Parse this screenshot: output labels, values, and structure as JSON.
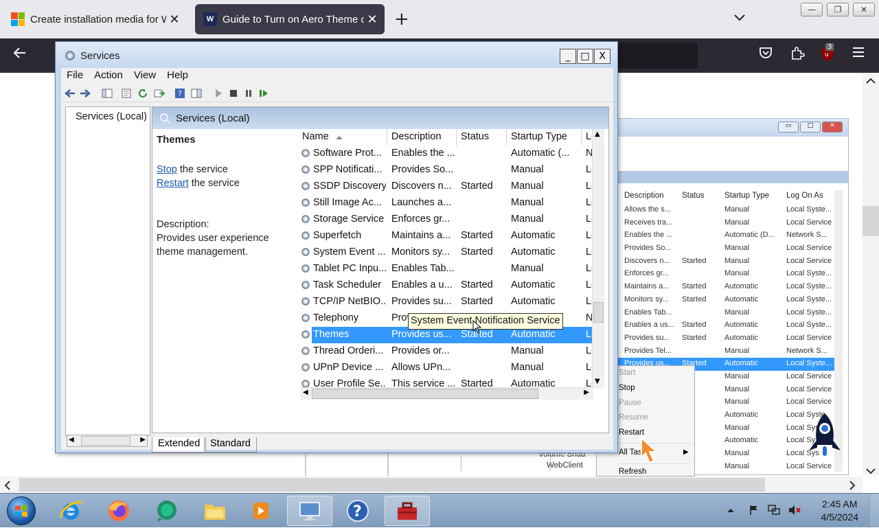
{
  "browser": {
    "tabs": [
      {
        "title": "Create installation media for W",
        "close": "✕"
      },
      {
        "title": "Guide to Turn on Aero Theme o",
        "close": "✕"
      }
    ],
    "new_tab": "+",
    "tab_list": "⌄",
    "window_controls": [
      "—",
      "❐",
      "✕"
    ],
    "extension_badge": "3"
  },
  "services_window": {
    "title": "Services",
    "controls": {
      "minimize": "_",
      "maximize": "□",
      "close": "X"
    },
    "menu": [
      "File",
      "Action",
      "View",
      "Help"
    ],
    "tree_root": "Services (Local)",
    "detail_header": "Services (Local)",
    "selected_service": {
      "name": "Themes",
      "stop_link": "Stop",
      "stop_suffix": " the service",
      "restart_link": "Restart",
      "restart_suffix": " the service",
      "description_label": "Description:",
      "description_line1": "Provides user experience",
      "description_line2": "theme management."
    },
    "columns": [
      "Name",
      "Description",
      "Status",
      "Startup Type",
      "Lo"
    ],
    "rows": [
      {
        "name": "Software Prot...",
        "desc": "Enables the ...",
        "status": "",
        "startup": "Automatic (...",
        "logon": "N"
      },
      {
        "name": "SPP Notificati...",
        "desc": "Provides So...",
        "status": "",
        "startup": "Manual",
        "logon": "Lo"
      },
      {
        "name": "SSDP Discovery",
        "desc": "Discovers n...",
        "status": "Started",
        "startup": "Manual",
        "logon": "Lo"
      },
      {
        "name": "Still Image Ac...",
        "desc": "Launches a...",
        "status": "",
        "startup": "Manual",
        "logon": "Lo"
      },
      {
        "name": "Storage Service",
        "desc": "Enforces gr...",
        "status": "",
        "startup": "Manual",
        "logon": "Lo"
      },
      {
        "name": "Superfetch",
        "desc": "Maintains a...",
        "status": "Started",
        "startup": "Automatic",
        "logon": "Lo"
      },
      {
        "name": "System Event ...",
        "desc": "Monitors sy...",
        "status": "Started",
        "startup": "Automatic",
        "logon": "Lo"
      },
      {
        "name": "Tablet PC Inpu...",
        "desc": "Enables Tab...",
        "status": "",
        "startup": "Manual",
        "logon": "Lo"
      },
      {
        "name": "Task Scheduler",
        "desc": "Enables a u...",
        "status": "Started",
        "startup": "Automatic",
        "logon": "Lo"
      },
      {
        "name": "TCP/IP NetBIO...",
        "desc": "Provides su...",
        "status": "Started",
        "startup": "Automatic",
        "logon": "Lo"
      },
      {
        "name": "Telephony",
        "desc": "Provides Tel...",
        "status": "",
        "startup": "Manual",
        "logon": "N"
      },
      {
        "name": "Themes",
        "desc": "Provides us...",
        "status": "Started",
        "startup": "Automatic",
        "logon": "Lo"
      },
      {
        "name": "Thread Orderi...",
        "desc": "Provides or...",
        "status": "",
        "startup": "Manual",
        "logon": "Lo"
      },
      {
        "name": "UPnP Device ...",
        "desc": "Allows UPn...",
        "status": "",
        "startup": "Manual",
        "logon": "Lo"
      },
      {
        "name": "User Profile Se...",
        "desc": "This service ...",
        "status": "Started",
        "startup": "Automatic",
        "logon": "Lo"
      }
    ],
    "tooltip": "System Event Notification Service",
    "view_tabs": [
      "Extended",
      "Standard"
    ]
  },
  "background_screenshot": {
    "columns": [
      "Description",
      "Status",
      "Startup Type",
      "Log On As"
    ],
    "rows": [
      [
        "Allows the s...",
        "",
        "Manual",
        "Local Syste..."
      ],
      [
        "Receives tra...",
        "",
        "Manual",
        "Local Service"
      ],
      [
        "Enables the ...",
        "",
        "Automatic (D...",
        "Network S..."
      ],
      [
        "Provides So...",
        "",
        "Manual",
        "Local Service"
      ],
      [
        "Discovers n...",
        "Started",
        "Manual",
        "Local Service"
      ],
      [
        "Enforces gr...",
        "",
        "Manual",
        "Local Syste..."
      ],
      [
        "Maintains a...",
        "Started",
        "Automatic",
        "Local Syste..."
      ],
      [
        "Monitors sy...",
        "Started",
        "Automatic",
        "Local Syste..."
      ],
      [
        "Enables Tab...",
        "",
        "Manual",
        "Local Syste..."
      ],
      [
        "Enables a us...",
        "Started",
        "Automatic",
        "Local Syste..."
      ],
      [
        "Provides su...",
        "Started",
        "Automatic",
        "Local Service"
      ],
      [
        "Provides Tel...",
        "",
        "Manual",
        "Network S..."
      ],
      [
        "Provides us...",
        "Started",
        "Automatic",
        "Local Syste..."
      ],
      [
        "",
        "",
        "Manual",
        "Local Service"
      ],
      [
        "",
        "",
        "Manual",
        "Local Service"
      ],
      [
        "",
        "",
        "Manual",
        "Local Service"
      ],
      [
        "",
        "ted",
        "Automatic",
        "Local Syste"
      ],
      [
        "",
        "",
        "Manual",
        "Local Sys"
      ],
      [
        "",
        "ted",
        "Automatic",
        "Local Sy"
      ],
      [
        "",
        "",
        "Manual",
        "Local Sys"
      ],
      [
        "",
        "",
        "Manual",
        "Local Service"
      ]
    ],
    "context_menu": {
      "start": "Start",
      "stop": "Stop",
      "pause": "Pause",
      "resume": "Resume",
      "restart": "Restart",
      "all_tasks": "All Tas",
      "refresh": "Refresh"
    },
    "left_items": [
      "Volume Shad",
      "WebClient"
    ]
  },
  "taskbar": {
    "time": "2:45 AM",
    "date": "4/5/2024"
  },
  "colors": {
    "selection": "#3399ff",
    "taskbar": "#8fa9c7",
    "browser_nav": "#2b2a33"
  }
}
